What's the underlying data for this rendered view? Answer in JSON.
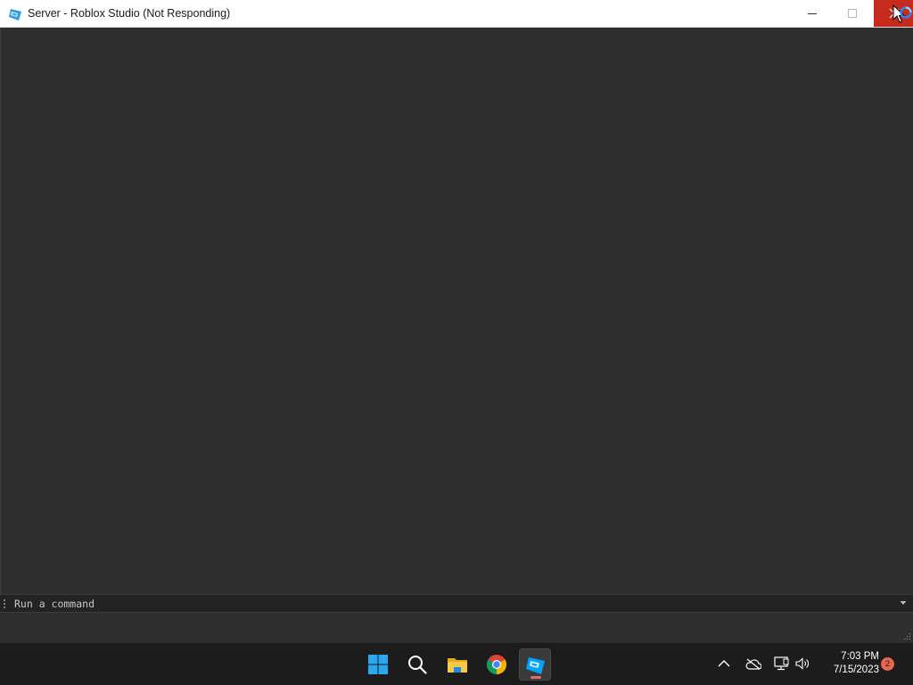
{
  "window": {
    "title": "Server - Roblox Studio (Not Responding)",
    "app_icon": "roblox-studio-icon",
    "controls": [
      "minimize-icon",
      "maximize-icon",
      "close-icon"
    ]
  },
  "command_bar": {
    "placeholder": "Run a command",
    "value": ""
  },
  "taskbar": {
    "apps": [
      {
        "name": "start",
        "icon": "windows-start-icon"
      },
      {
        "name": "search",
        "icon": "search-icon"
      },
      {
        "name": "file-explorer",
        "icon": "folder-icon"
      },
      {
        "name": "chrome",
        "icon": "chrome-icon"
      },
      {
        "name": "roblox-studio",
        "icon": "roblox-studio-icon",
        "active": true
      }
    ],
    "tray": {
      "icons": [
        "chevron-up-icon",
        "onedrive-offline-icon",
        "network-icon",
        "volume-icon"
      ],
      "time": "7:03 PM",
      "date": "7/15/2023",
      "notification_count": "2"
    }
  },
  "colors": {
    "viewport_bg": "#2e2e2e",
    "close_hover": "#c42b1c",
    "taskbar_bg": "#1c1c1c",
    "badge": "#e8664d",
    "studio_blue": "#00a2ff"
  }
}
